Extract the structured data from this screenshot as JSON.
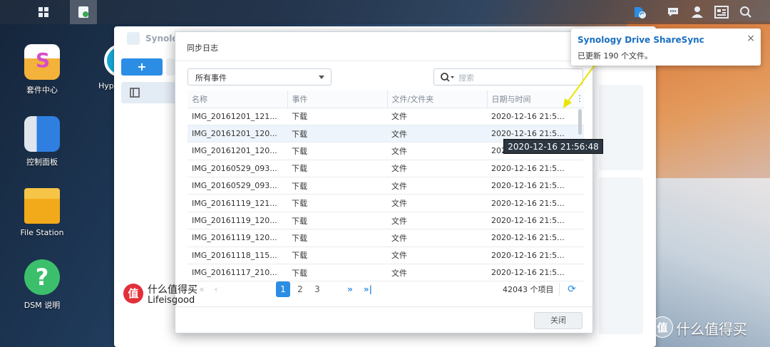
{
  "taskbar": {
    "buttons": [
      {
        "icon": "apps-grid-icon"
      },
      {
        "icon": "synology-drive-icon",
        "active": true
      }
    ],
    "right_icons": [
      "sync-status-icon",
      "chat-icon",
      "user-icon",
      "widgets-icon",
      "search-icon"
    ]
  },
  "desktop": {
    "icons": [
      {
        "label": "套件中心"
      },
      {
        "label": "Hype"
      },
      {
        "label": "控制面板"
      },
      {
        "label": "File Station"
      },
      {
        "label": "DSM 说明"
      }
    ]
  },
  "back_window": {
    "title": "Synolog",
    "add_label": "+"
  },
  "dialog": {
    "title": "同步日志",
    "filter": {
      "selected": "所有事件"
    },
    "search": {
      "placeholder": "搜索"
    },
    "columns": [
      "名称",
      "事件",
      "文件/文件夹",
      "日期与时间"
    ],
    "rows": [
      {
        "name": "IMG_20161201_121...",
        "event": "下载",
        "type": "文件",
        "datetime": "2020-12-16 21:5..."
      },
      {
        "name": "IMG_20161201_120...",
        "event": "下载",
        "type": "文件",
        "datetime": "2020-12-16 21:5..."
      },
      {
        "name": "IMG_20161201_120...",
        "event": "下载",
        "type": "文件",
        "datetime": "2020-12-16 21:5..."
      },
      {
        "name": "IMG_20160529_093...",
        "event": "下载",
        "type": "文件",
        "datetime": "2020-12-16 21:5..."
      },
      {
        "name": "IMG_20160529_093...",
        "event": "下载",
        "type": "文件",
        "datetime": "2020-12-16 21:5..."
      },
      {
        "name": "IMG_20161119_121...",
        "event": "下载",
        "type": "文件",
        "datetime": "2020-12-16 21:5..."
      },
      {
        "name": "IMG_20161119_120...",
        "event": "下载",
        "type": "文件",
        "datetime": "2020-12-16 21:5..."
      },
      {
        "name": "IMG_20161119_120...",
        "event": "下载",
        "type": "文件",
        "datetime": "2020-12-16 21:5..."
      },
      {
        "name": "IMG_20161118_115...",
        "event": "下载",
        "type": "文件",
        "datetime": "2020-12-16 21:5..."
      },
      {
        "name": "IMG_20161117_210...",
        "event": "下载",
        "type": "文件",
        "datetime": "2020-12-16 21:5..."
      }
    ],
    "selected_row": 1,
    "pagination": {
      "first": "«",
      "prev": "‹",
      "pages": [
        "1",
        "2",
        "3"
      ],
      "current_page": "1",
      "next": "»",
      "last": "»|",
      "total": "42043 个项目"
    },
    "close_label": "关闭"
  },
  "tooltip": {
    "text": "2020-12-16 21:56:48"
  },
  "notification": {
    "title": "Synology Drive ShareSync",
    "message": "已更新 190 个文件。",
    "close": "×"
  },
  "watermark": {
    "badge": "值",
    "line1": "什么值得买",
    "line2": "Lifeisgood",
    "corner": "什么值得买"
  },
  "colors": {
    "accent": "#2b8de4",
    "notify_title": "#1a6fc0",
    "annotation_arrow": "#e8e600"
  }
}
